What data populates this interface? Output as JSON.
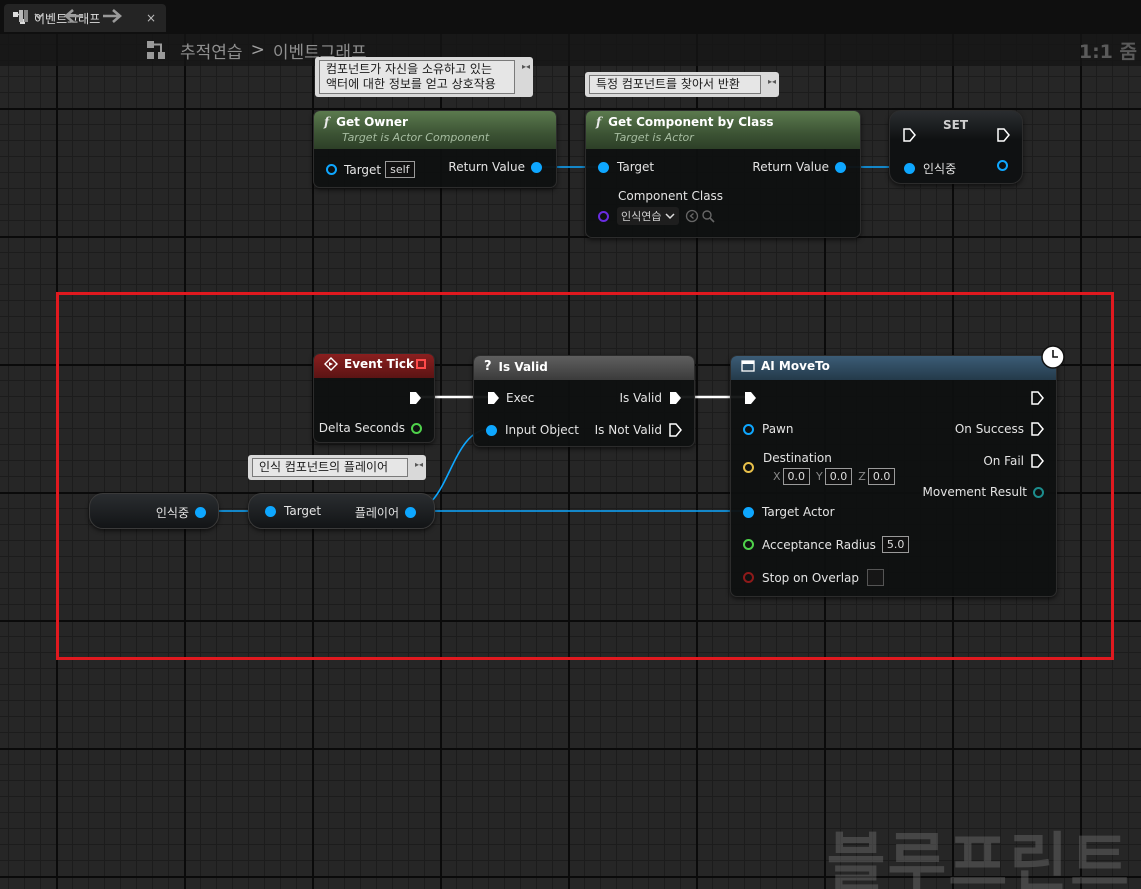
{
  "tab": {
    "label": "이벤트그래프",
    "close": "×"
  },
  "toolbar": {
    "bookmark": "▌▾",
    "back": "←",
    "forward": "→"
  },
  "breadcrumb": {
    "root": "추적연습",
    "separator": ">",
    "current": "이벤트그래프"
  },
  "zoom_label": "1:1 줌",
  "watermark": "블루프린트",
  "comments": {
    "get_owner": "컴포넌트가 자신을 소유하고 있는\n액터에 대한 정보를 얻고 상호작용",
    "get_component": "특정 컴포넌트를 찾아서 반환",
    "player": "인식 컴포넌트의 플레이어"
  },
  "nodes": {
    "get_owner": {
      "title": "Get Owner",
      "subtitle": "Target is Actor Component",
      "target_label": "Target",
      "target_value": "self",
      "return_label": "Return Value"
    },
    "get_component": {
      "title": "Get Component by Class",
      "subtitle": "Target is Actor",
      "target_label": "Target",
      "return_label": "Return Value",
      "class_label": "Component Class",
      "class_value": "인식연습"
    },
    "set": {
      "title": "SET",
      "var_label": "인식중"
    },
    "event_tick": {
      "title": "Event Tick",
      "delta_label": "Delta Seconds"
    },
    "is_valid": {
      "title": "Is Valid",
      "exec_label": "Exec",
      "input_label": "Input Object",
      "is_valid_label": "Is Valid",
      "is_not_valid_label": "Is Not Valid"
    },
    "ai_moveto": {
      "title": "AI MoveTo",
      "pawn_label": "Pawn",
      "destination_label": "Destination",
      "x_label": "X",
      "x_value": "0.0",
      "y_label": "Y",
      "y_value": "0.0",
      "z_label": "Z",
      "z_value": "0.0",
      "target_actor_label": "Target Actor",
      "acceptance_label": "Acceptance Radius",
      "acceptance_value": "5.0",
      "stop_label": "Stop on Overlap",
      "on_success_label": "On Success",
      "on_fail_label": "On Fail",
      "movement_result_label": "Movement Result"
    },
    "var_get": {
      "label": "인식중"
    },
    "player_get": {
      "target_label": "Target",
      "output_label": "플레이어"
    }
  },
  "colors": {
    "exec": "#ffffff",
    "object_pin": "#0ea7ff",
    "float_pin": "#4fd24b",
    "vector_pin": "#e8c04a",
    "bool_pin": "#8e1a1a",
    "class_pin": "#6a2ce0",
    "selection": "#e0191f"
  }
}
